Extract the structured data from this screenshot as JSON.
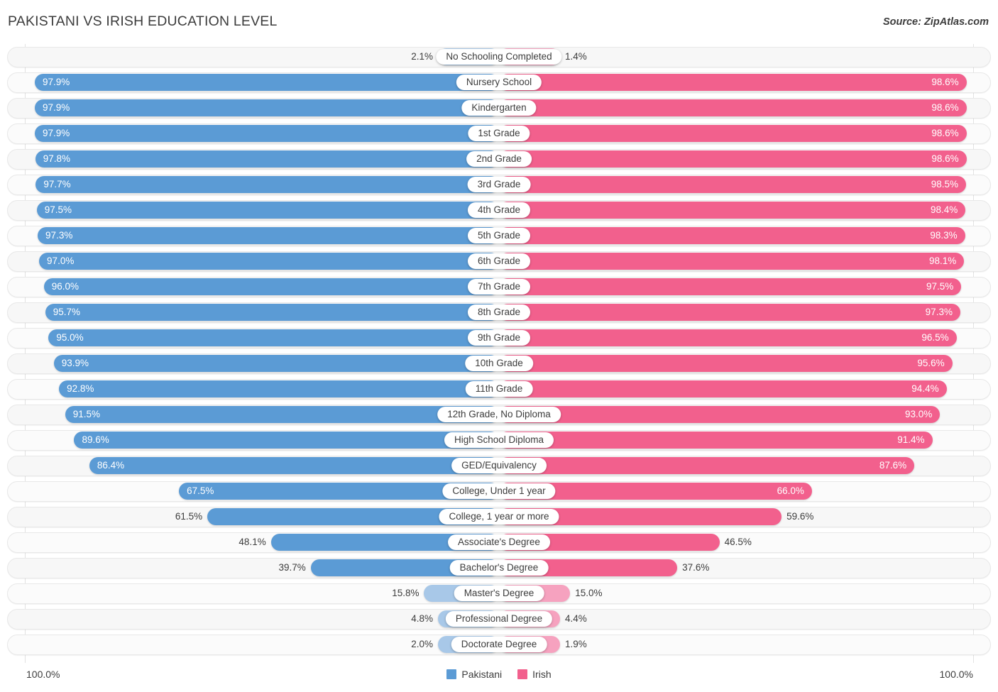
{
  "header": {
    "title": "PAKISTANI VS IRISH EDUCATION LEVEL",
    "source": "Source: ZipAtlas.com"
  },
  "legend": {
    "items": [
      {
        "label": "Pakistani",
        "color": "#5b9bd5",
        "swatch": "blue"
      },
      {
        "label": "Irish",
        "color": "#f2608d",
        "swatch": "pink"
      }
    ]
  },
  "axis": {
    "min_label": "100.0%",
    "max_label": "100.0%"
  },
  "chart_data": {
    "type": "bar",
    "title": "PAKISTANI VS IRISH EDUCATION LEVEL",
    "subtitle": "",
    "xlabel": "",
    "ylabel": "",
    "orientation": "horizontal-diverging",
    "axis_max": 100.0,
    "axis_range": [
      0,
      100
    ],
    "grid": false,
    "legend_position": "bottom-center",
    "categories": [
      "No Schooling Completed",
      "Nursery School",
      "Kindergarten",
      "1st Grade",
      "2nd Grade",
      "3rd Grade",
      "4th Grade",
      "5th Grade",
      "6th Grade",
      "7th Grade",
      "8th Grade",
      "9th Grade",
      "10th Grade",
      "11th Grade",
      "12th Grade, No Diploma",
      "High School Diploma",
      "GED/Equivalency",
      "College, Under 1 year",
      "College, 1 year or more",
      "Associate's Degree",
      "Bachelor's Degree",
      "Master's Degree",
      "Professional Degree",
      "Doctorate Degree"
    ],
    "series": [
      {
        "name": "Pakistani",
        "color": "#5b9bd5",
        "side": "left",
        "values": [
          2.1,
          97.9,
          97.9,
          97.9,
          97.8,
          97.7,
          97.5,
          97.3,
          97.0,
          96.0,
          95.7,
          95.0,
          93.9,
          92.8,
          91.5,
          89.6,
          86.4,
          67.5,
          61.5,
          48.1,
          39.7,
          15.8,
          4.8,
          2.0
        ],
        "labels": [
          "2.1%",
          "97.9%",
          "97.9%",
          "97.9%",
          "97.8%",
          "97.7%",
          "97.5%",
          "97.3%",
          "97.0%",
          "96.0%",
          "95.7%",
          "95.0%",
          "93.9%",
          "92.8%",
          "91.5%",
          "89.6%",
          "86.4%",
          "67.5%",
          "61.5%",
          "48.1%",
          "39.7%",
          "15.8%",
          "4.8%",
          "2.0%"
        ]
      },
      {
        "name": "Irish",
        "color": "#f2608d",
        "side": "right",
        "values": [
          1.4,
          98.6,
          98.6,
          98.6,
          98.6,
          98.5,
          98.4,
          98.3,
          98.1,
          97.5,
          97.3,
          96.5,
          95.6,
          94.4,
          93.0,
          91.4,
          87.6,
          66.0,
          59.6,
          46.5,
          37.6,
          15.0,
          4.4,
          1.9
        ],
        "labels": [
          "1.4%",
          "98.6%",
          "98.6%",
          "98.6%",
          "98.6%",
          "98.5%",
          "98.4%",
          "98.3%",
          "98.1%",
          "97.5%",
          "97.3%",
          "96.5%",
          "95.6%",
          "94.4%",
          "93.0%",
          "91.4%",
          "87.6%",
          "66.0%",
          "59.6%",
          "46.5%",
          "37.6%",
          "15.0%",
          "4.4%",
          "1.9%"
        ]
      }
    ]
  }
}
